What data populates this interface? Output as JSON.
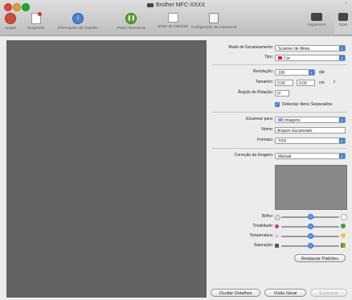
{
  "window": {
    "title": "Brother MFC-XXXX"
  },
  "toolbar": {
    "items": [
      {
        "label": "Apagar",
        "icon": "delete-icon"
      },
      {
        "label": "Suspender",
        "icon": "hold-icon"
      },
      {
        "label": "Informações da Trabalho",
        "icon": "info-icon"
      },
      {
        "label": "Parar Impressora",
        "icon": "pause-icon"
      },
      {
        "label": "Níveis de materiais",
        "icon": "supply-levels-icon"
      },
      {
        "label": "Configuração da impressora",
        "icon": "printer-setup-icon"
      },
      {
        "label": "Impressora",
        "icon": "printer-icon"
      },
      {
        "label": "Scan",
        "icon": "scanner-icon"
      }
    ]
  },
  "form": {
    "modo_label": "Modo de Escaneamento:",
    "modo_value": "Scanner de Mesa",
    "tipo_label": "Tipo:",
    "tipo_value": "Cor",
    "resolucao_label": "Resolução:",
    "resolucao_value": "100",
    "resolucao_unit": "dpi",
    "tamanho_label": "Tamanho:",
    "tamanho_w": "0.00",
    "tamanho_h": "0.00",
    "tamanho_unit": "cm",
    "angulo_label": "Ângulo de Rotação:",
    "angulo_value": "0°",
    "detectar_label": "Detectar Itens Separados",
    "escanear_para_label": "Escanear para:",
    "escanear_para_value": "Imagens",
    "nome_label": "Nome:",
    "nome_value": "Arquivo Escaneado",
    "formato_label": "Formato:",
    "formato_value": "TIFF",
    "correcao_label": "Correção da Imagem:",
    "correcao_value": "Manual",
    "brilho_label": "Brilho:",
    "tonalidade_label": "Tonalidade:",
    "temperatura_label": "Temperatura:",
    "saturacao_label": "Saturação:",
    "sliders": {
      "brilho": 0.5,
      "tonalidade": 0.5,
      "temperatura": 0.5,
      "saturacao": 0.5
    },
    "restaurar_label": "Restaurar Padrões"
  },
  "footer": {
    "ocultar_label": "Ocultar Detalhes",
    "visao_label": "Visão Geral",
    "escanear_label": "Escanear"
  },
  "colors": {
    "accent": "#3d7fe0",
    "preview_bg": "#636363"
  }
}
